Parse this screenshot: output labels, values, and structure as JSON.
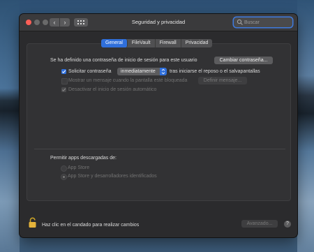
{
  "window": {
    "title": "Seguridad y privacidad",
    "search_placeholder": "Buscar"
  },
  "tabs": [
    {
      "label": "General",
      "active": true
    },
    {
      "label": "FileVault",
      "active": false
    },
    {
      "label": "Firewall",
      "active": false
    },
    {
      "label": "Privacidad",
      "active": false
    }
  ],
  "general": {
    "password_set_text": "Se ha definido una contraseña de inicio de sesión para este usuario",
    "change_password_button": "Cambiar contraseña...",
    "require_password": {
      "label": "Solicitar contraseña",
      "checked": true
    },
    "require_when_select": "inmediatamente",
    "require_suffix": "tras iniciarse el reposo o el salvapantallas",
    "show_message": {
      "label": "Mostrar un mensaje cuando la pantalla esté bloqueada",
      "checked": false,
      "enabled": false
    },
    "set_message_button": "Definir mensaje...",
    "disable_autologin": {
      "label": "Desactivar el inicio de sesión automático",
      "checked": true,
      "enabled": false
    },
    "allow_apps_label": "Permitir apps descargadas de:",
    "radio_options": [
      {
        "label": "App Store",
        "selected": false
      },
      {
        "label": "App Store y desarrolladores identificados",
        "selected": true
      }
    ]
  },
  "footer": {
    "lock_text": "Haz clic en el candado para realizar cambios",
    "advanced_button": "Avanzado...",
    "help_button": "?"
  },
  "colors": {
    "accent": "#2f6fdb",
    "close": "#ff5f57"
  }
}
